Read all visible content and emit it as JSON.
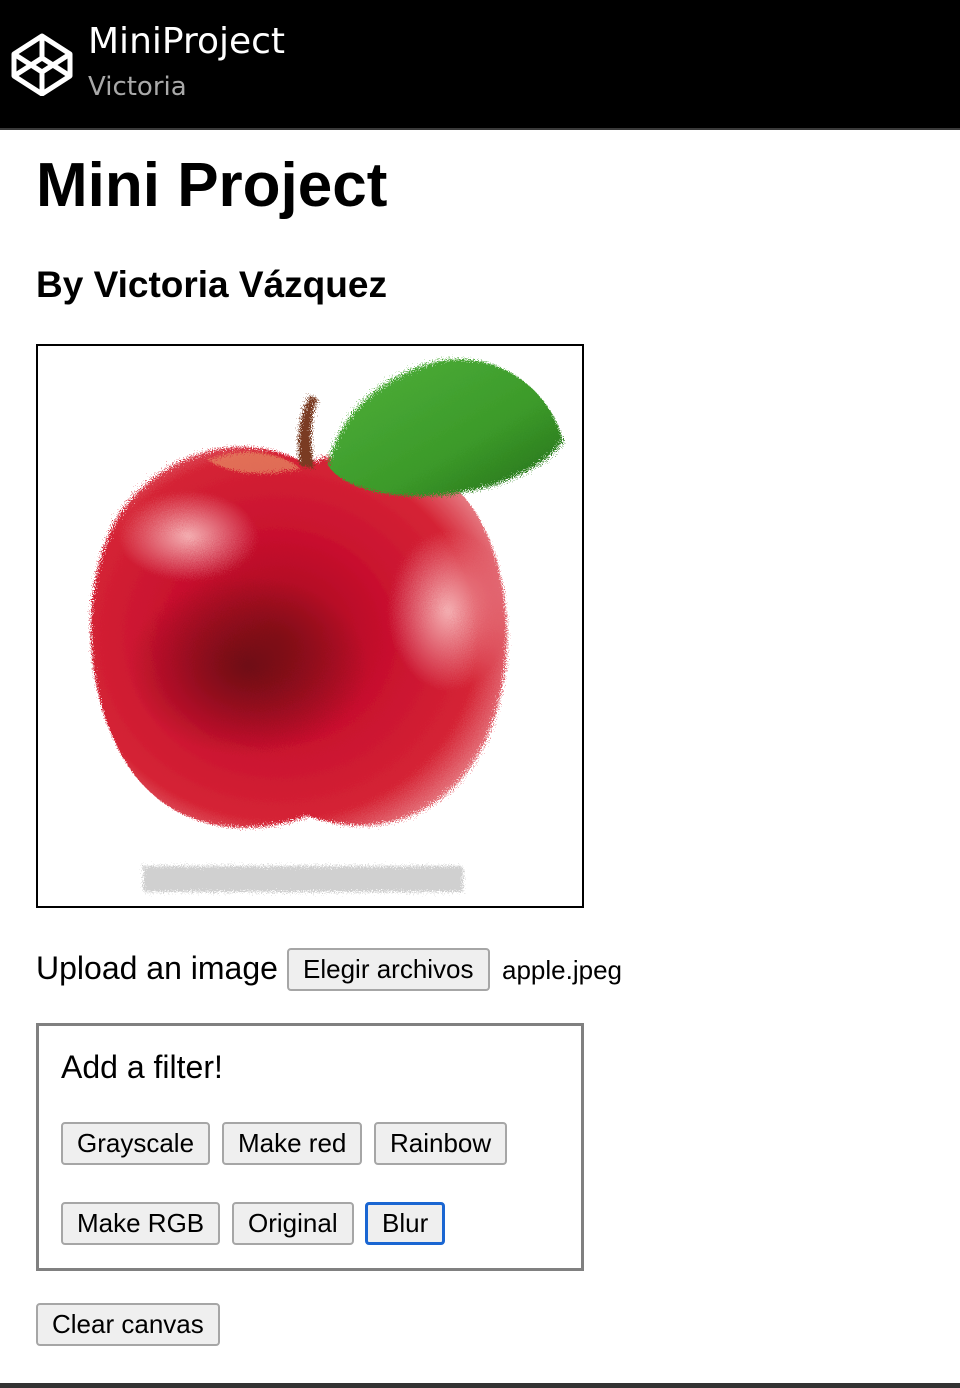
{
  "header": {
    "title": "MiniProject",
    "subtitle": "Victoria",
    "logo_icon": "codepen-cube-icon"
  },
  "main": {
    "heading": "Mini Project",
    "byline": "By Victoria Vázquez",
    "canvas_image": "apple-painting"
  },
  "upload": {
    "label": "Upload an image",
    "button_label": "Elegir archivos",
    "file_name": "apple.jpeg"
  },
  "filters": {
    "title": "Add a filter!",
    "buttons": [
      "Grayscale",
      "Make red",
      "Rainbow",
      "Make RGB",
      "Original",
      "Blur"
    ],
    "focused": "Blur"
  },
  "clear_label": "Clear canvas",
  "colors": {
    "header_bg": "#000000",
    "focus_ring": "#1a66d2",
    "apple_red": "#c8102e",
    "leaf_green": "#3c9a2a"
  }
}
